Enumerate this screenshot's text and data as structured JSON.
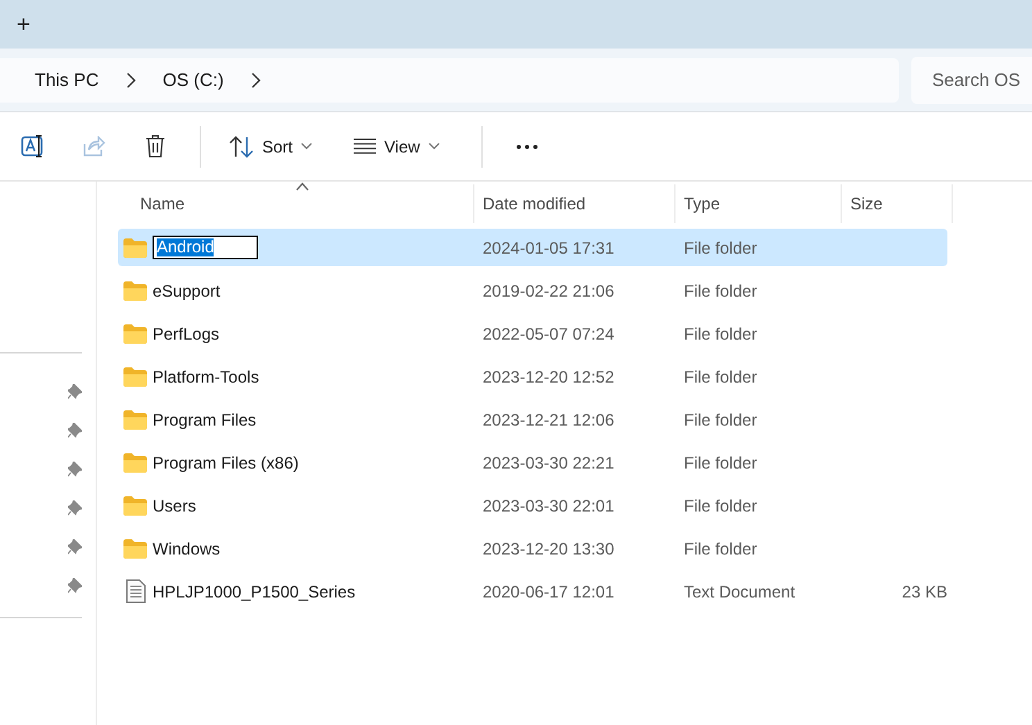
{
  "tab_strip": {
    "new_tab": "+"
  },
  "address_bar": {
    "segments": [
      "This PC",
      "OS (C:)"
    ]
  },
  "search": {
    "placeholder": "Search OS"
  },
  "toolbar": {
    "items": [
      {
        "kind": "rename",
        "disabled": false
      },
      {
        "kind": "share",
        "disabled": true
      },
      {
        "kind": "delete",
        "disabled": false
      },
      {
        "kind": "separator"
      },
      {
        "kind": "sort",
        "label": "Sort",
        "disabled": false
      },
      {
        "kind": "view",
        "label": "View",
        "disabled": false
      },
      {
        "kind": "separator"
      },
      {
        "kind": "more",
        "disabled": false
      }
    ]
  },
  "quick_access": [
    {
      "pinned": true
    },
    {
      "pinned": true
    },
    {
      "pinned": true
    },
    {
      "pinned": true
    },
    {
      "pinned": true
    },
    {
      "pinned": true
    }
  ],
  "table": {
    "columns": [
      {
        "label": "Name",
        "sorted": true
      },
      {
        "label": "Date modified",
        "sorted": false
      },
      {
        "label": "Type",
        "sorted": false
      },
      {
        "label": "Size",
        "sorted": false
      }
    ],
    "rows": [
      {
        "kind": "folder",
        "name": "Android",
        "date": "2024-01-05 17:31",
        "type": "File folder",
        "selected": true,
        "editing": true
      },
      {
        "kind": "folder",
        "name": "eSupport",
        "date": "2019-02-22 21:06",
        "type": "File folder",
        "selected": false,
        "editing": false
      },
      {
        "kind": "folder",
        "name": "PerfLogs",
        "date": "2022-05-07 07:24",
        "type": "File folder",
        "selected": false,
        "editing": false
      },
      {
        "kind": "folder",
        "name": "Platform-Tools",
        "date": "2023-12-20 12:52",
        "type": "File folder",
        "selected": false,
        "editing": false
      },
      {
        "kind": "folder",
        "name": "Program Files",
        "date": "2023-12-21 12:06",
        "type": "File folder",
        "selected": false,
        "editing": false
      },
      {
        "kind": "folder",
        "name": "Program Files (x86)",
        "date": "2023-03-30 22:21",
        "type": "File folder",
        "selected": false,
        "editing": false
      },
      {
        "kind": "folder",
        "name": "Users",
        "date": "2023-03-30 22:01",
        "type": "File folder",
        "selected": false,
        "editing": false
      },
      {
        "kind": "folder",
        "name": "Windows",
        "date": "2023-12-20 13:30",
        "type": "File folder",
        "selected": false,
        "editing": false
      },
      {
        "kind": "document",
        "name": "HPLJP1000_P1500_Series",
        "date": "2020-06-17 12:01",
        "type": "Text Document",
        "size": "23 KB",
        "selected": false,
        "editing": false
      }
    ]
  }
}
